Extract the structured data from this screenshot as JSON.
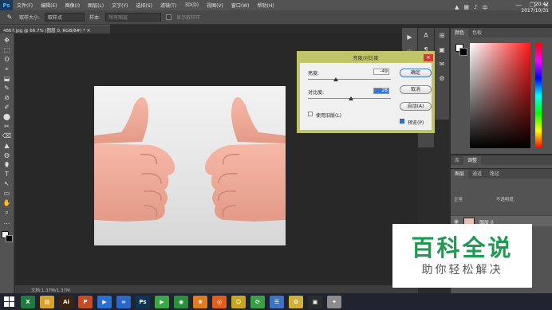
{
  "app": {
    "logo": "Ps"
  },
  "menu": [
    "文件(F)",
    "编辑(E)",
    "图像(I)",
    "图层(L)",
    "文字(Y)",
    "选择(S)",
    "滤镜(T)",
    "3D(D)",
    "视图(V)",
    "窗口(W)",
    "帮助(H)"
  ],
  "window_controls": {
    "minimize": "—",
    "restore": "❐",
    "close": "✕"
  },
  "options": {
    "sample_size_label": "取样大小:",
    "sample_size_value": "取样点",
    "sample_label": "样本:",
    "sample_value": "所有图层",
    "show_ring_label": "显示取样环"
  },
  "document": {
    "tab_label": "4867.jpg @ 66.7% (图层 0, RGB/8#) * ✕",
    "status_text": "文档:1.37M/1.37M"
  },
  "tools": [
    "✥",
    "⬚",
    "ʘ",
    "⌖",
    "⬓",
    "✎",
    "⊘",
    "✐",
    "⬤",
    "✂",
    "⌫",
    "▲",
    "◍",
    "⬮",
    "T",
    "↖",
    "▭",
    "✋",
    "⌕",
    "…"
  ],
  "dialog": {
    "title": "亮度/对比度",
    "close": "✕",
    "brightness_label": "亮度:",
    "brightness_value": "-49",
    "contrast_label": "对比度:",
    "contrast_value": "28",
    "brightness_level": -49,
    "contrast_level": 28,
    "use_legacy_label": "使用旧版(L)",
    "use_legacy_checked": false,
    "preview_label": "预览(P)",
    "preview_checked": true,
    "ok": "确定",
    "cancel": "取消",
    "auto": "自动(A)"
  },
  "panels": {
    "color_tabs": [
      "颜色",
      "色板"
    ],
    "adjust_tabs": [
      "库",
      "调整"
    ],
    "layers_tabs": [
      "图层",
      "通道",
      "路径"
    ],
    "blend_mode": "正常",
    "opacity_label": "不透明度:",
    "layer_name": "图层 0"
  },
  "watermark": {
    "main": "百科全说",
    "sub": "助你轻松解决"
  },
  "taskbar": {
    "apps": [
      {
        "name": "excel",
        "label": "X",
        "color": "#1f7a3f"
      },
      {
        "name": "explorer",
        "label": "▤",
        "color": "#d9a12c"
      },
      {
        "name": "illustrator",
        "label": "Ai",
        "color": "#3b2410"
      },
      {
        "name": "powerpoint",
        "label": "P",
        "color": "#c44b22"
      },
      {
        "name": "media",
        "label": "▶",
        "color": "#2a6fd1"
      },
      {
        "name": "baidu",
        "label": "∞",
        "color": "#2b67c9"
      },
      {
        "name": "photoshop",
        "label": "Ps",
        "color": "#0f3554"
      },
      {
        "name": "player",
        "label": "▶",
        "color": "#39a845"
      },
      {
        "name": "browser",
        "label": "◉",
        "color": "#2a8f3c"
      },
      {
        "name": "app1",
        "label": "❀",
        "color": "#e07c1c"
      },
      {
        "name": "app2",
        "label": "◎",
        "color": "#e05d1c"
      },
      {
        "name": "app3",
        "label": "☺",
        "color": "#c8a620"
      },
      {
        "name": "app4",
        "label": "⟳",
        "color": "#3aa045"
      },
      {
        "name": "app5",
        "label": "☰",
        "color": "#3d73c4"
      },
      {
        "name": "app6",
        "label": "✿",
        "color": "#d1b035"
      },
      {
        "name": "app7",
        "label": "▣",
        "color": "#2c2c2c"
      },
      {
        "name": "app8",
        "label": "✦",
        "color": "#8b8b8b"
      }
    ],
    "time": "20:42",
    "date": "2017/10/31"
  }
}
